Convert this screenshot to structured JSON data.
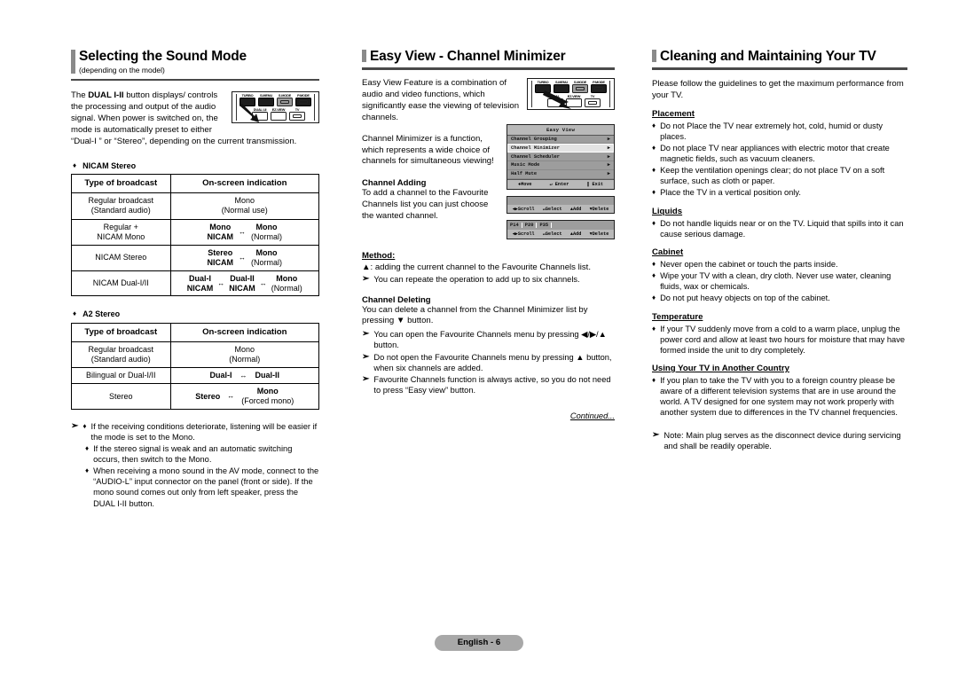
{
  "footer": {
    "page_label": "English - 6"
  },
  "col1": {
    "title": "Selecting the Sound Mode",
    "subtitle": "(depending on the model)",
    "intro_1": "The ",
    "intro_bold": "DUAL I-II",
    "intro_2": " button displays/ controls the processing and output of the audio signal. When power is switched on, the mode is automatically preset to either “Dual-I ” or “Stereo”, depending on the current transmission.",
    "remote": {
      "keys_top": [
        "TURBO",
        "S.MENU",
        "S.MODE",
        "P.MODE"
      ],
      "keys_bottom": [
        "DUAL I-II",
        "EZ.VIEW",
        "TV"
      ]
    },
    "table1": {
      "caption": "NICAM Stereo",
      "diamond": "♦",
      "headers": [
        "Type of broadcast",
        "On-screen indication"
      ],
      "rows": [
        {
          "type_line1": "Regular broadcast",
          "type_line2": "(Standard audio)",
          "ind_kind": "stack",
          "ind_a": "Mono",
          "ind_b": "(Normal use)"
        },
        {
          "type_line1": "Regular +",
          "type_line2": "NICAM Mono",
          "ind_kind": "pair",
          "left_top": "Mono",
          "left_bot": "NICAM",
          "swap": "↔",
          "right_top": "Mono",
          "right_bot": "(Normal)"
        },
        {
          "type_line1": "NICAM Stereo",
          "type_line2": "",
          "ind_kind": "pair",
          "left_top": "Stereo",
          "left_bot": "NICAM",
          "swap": "↔",
          "right_top": "Mono",
          "right_bot": "(Normal)"
        },
        {
          "type_line1": "NICAM Dual-I/II",
          "type_line2": "",
          "ind_kind": "triple",
          "left_top": "Dual-I",
          "left_bot": "NICAM",
          "swap": "↔",
          "mid_top": "Dual-II",
          "mid_bot": "NICAM",
          "swap2": "↔",
          "right_top": "Mono",
          "right_bot": "(Normal)"
        }
      ]
    },
    "table2": {
      "caption": "A2 Stereo",
      "diamond": "♦",
      "headers": [
        "Type of broadcast",
        "On-screen indication"
      ],
      "rows": [
        {
          "type_line1": "Regular broadcast",
          "type_line2": "(Standard audio)",
          "ind_kind": "stack",
          "ind_a": "Mono",
          "ind_b": "(Normal)"
        },
        {
          "type_line1": "Bilingual or Dual-I/II",
          "type_line2": "",
          "ind_kind": "inline",
          "left_top": "Dual-I",
          "swap": "↔",
          "right_top": "Dual-II"
        },
        {
          "type_line1": "Stereo",
          "type_line2": "",
          "ind_kind": "pair2",
          "left_top": "Stereo",
          "swap": "↔",
          "right_top": "Mono",
          "right_bot": "(Forced mono)"
        }
      ]
    },
    "notes": {
      "arrow": "➢",
      "diamond": "♦",
      "items": [
        "If the receiving conditions deteriorate, listening will be easier if the mode is set to the Mono.",
        "If the stereo signal is weak and an automatic switching occurs, then switch to the Mono.",
        "When receiving a mono sound in the AV mode, connect to the “AUDIO-L” input connector on the panel (front or side). If the mono sound comes out only from left speaker, press the DUAL I-II button."
      ]
    }
  },
  "col2": {
    "title": "Easy View - Channel Minimizer",
    "para_1": "Easy View Feature is a combination of audio and video functions, which significantly ease the viewing of television channels.",
    "para_2": "Channel Minimizer is a function, which represents a wide choice of channels for simultaneous viewing!",
    "remote": {
      "keys_top": [
        "TURBO",
        "S.MENU",
        "S.MODE",
        "P.MODE"
      ],
      "keys_bottom": [
        "DUAL",
        "EZ.VIEW",
        "TV"
      ]
    },
    "osd_menu": {
      "title": "Easy View",
      "items": [
        {
          "label": "Channel Grouping",
          "arrow": "▶",
          "selected": false
        },
        {
          "label": "Channel Minimizer",
          "arrow": "▶",
          "selected": true
        },
        {
          "label": "Channel Scheduler",
          "arrow": "▶",
          "selected": false
        },
        {
          "label": "Music Mode",
          "arrow": "▶",
          "selected": false
        },
        {
          "label": "Half Mute",
          "arrow": "▶",
          "selected": false
        }
      ],
      "footer": [
        "♦Move",
        "↵ Enter",
        "‖ Exit"
      ]
    },
    "osd_bar_1": {
      "hints": [
        "◀▶Scroll",
        "↵Select",
        "▲Add",
        "▼Delete"
      ]
    },
    "osd_bar_2": {
      "channels": [
        "P14",
        "P20",
        "P35"
      ],
      "hints": [
        "◀▶Scroll",
        "↵Select",
        "▲Add",
        "▼Delete"
      ]
    },
    "channel_adding": {
      "heading": "Channel Adding",
      "body": "To add a channel to the Favourite Channels list you can just choose the wanted channel."
    },
    "method": {
      "heading": "Method:",
      "line": "▲: adding the current channel to the Favourite Channels list.",
      "arrow": "➢",
      "note": "You can repeate the operation to add up to six channels."
    },
    "channel_deleting": {
      "heading": "Channel Deleting",
      "body": "You can delete a channel from the Channel Minimizer list by pressing ▼ button.",
      "arrow": "➢",
      "items": [
        "You can open the Favourite Channels menu by pressing ◀/▶/▲ button.",
        "Do not open the Favourite Channels menu by pressing ▲ button, when six channels are added.",
        "Favourite Channels function is always active, so you do not need to press “Easy view” button."
      ]
    },
    "continued": "Continued..."
  },
  "col3": {
    "title": "Cleaning and Maintaining Your TV",
    "intro": "Please follow the guidelines to get the maximum performance from your TV.",
    "diamond": "♦",
    "arrow": "➢",
    "sections": [
      {
        "heading": "Placement",
        "items": [
          "Do not Place the TV near extremely hot, cold, humid or dusty places.",
          "Do not place TV near appliances with electric motor that create magnetic fields, such as vacuum cleaners.",
          "Keep the ventilation openings clear; do not place TV on a soft surface, such as cloth or paper.",
          "Place the TV in a vertical position only."
        ]
      },
      {
        "heading": "Liquids",
        "items": [
          "Do not handle liquids near or on the TV. Liquid that spills into it can cause serious damage."
        ]
      },
      {
        "heading": "Cabinet",
        "items": [
          "Never open the cabinet or touch the parts inside.",
          "Wipe your TV with a clean, dry cloth. Never use water, cleaning fluids, wax or chemicals.",
          "Do not put heavy objects on top of the cabinet."
        ]
      },
      {
        "heading": "Temperature",
        "items": [
          "If your TV suddenly move from a cold to a warm place, unplug the power cord and allow at least two hours for moisture that may have formed inside the unit to dry completely."
        ]
      },
      {
        "heading": "Using Your TV in Another Country",
        "items": [
          "If you plan to take the TV with you to a foreign country please be aware of a different television systems that are in use around the world. A TV designed for one system may not work properly with another system due to differences in the TV channel frequencies."
        ]
      }
    ],
    "note": "Note: Main plug serves as the disconnect device during servicing and shall be readily operable."
  }
}
